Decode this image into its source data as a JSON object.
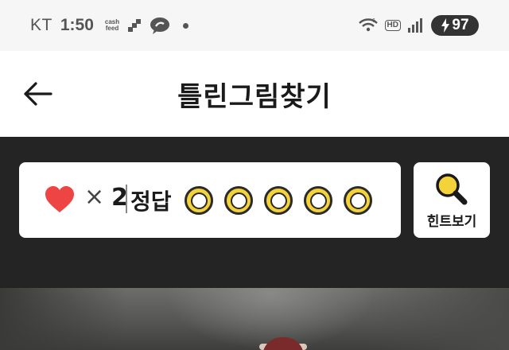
{
  "status_bar": {
    "carrier": "KT",
    "time": "1:50",
    "cashfeed_top": "cash",
    "cashfeed_bottom": "feed",
    "hd_badge": "HD",
    "battery": "97"
  },
  "header": {
    "title": "틀린그림찾기",
    "back_icon": "arrow-left-icon"
  },
  "game": {
    "lives_symbol": "×",
    "lives_count": "2",
    "answer_label": "정답",
    "answer_slots_total": 5,
    "answer_slots_found": 0,
    "hint_label": "힌트보기",
    "colors": {
      "panel_bg": "#242424",
      "heart": "#ef4444",
      "slot": "#f3d23a",
      "hint_icon": "#f3d23a"
    }
  }
}
